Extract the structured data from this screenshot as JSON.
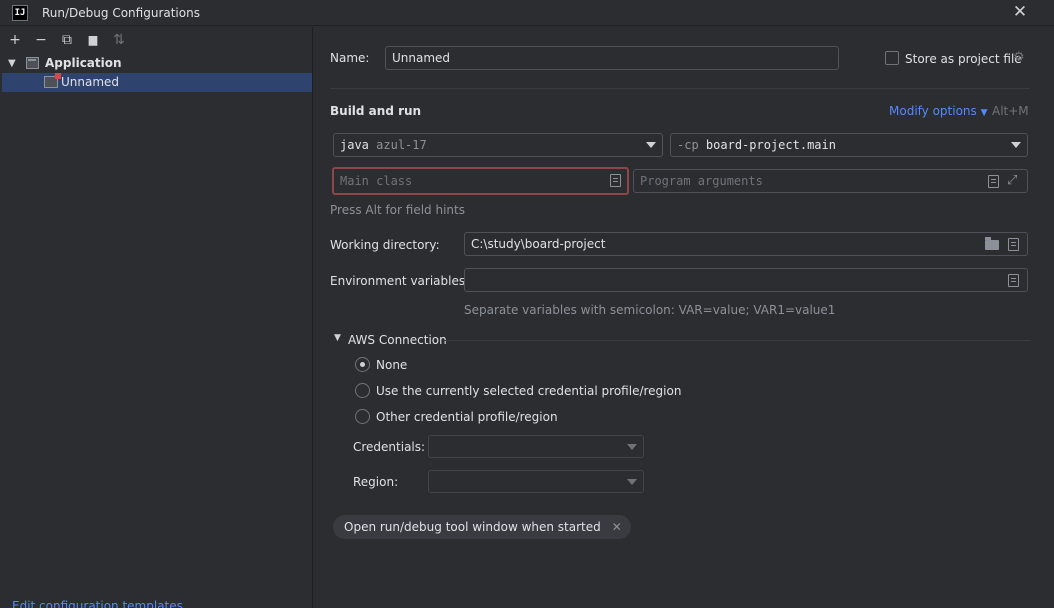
{
  "window": {
    "app_icon_text": "IJ",
    "title": "Run/Debug Configurations",
    "close_glyph": "✕"
  },
  "toolbar": {
    "add": "+",
    "remove": "−",
    "copy": "⧉",
    "folder": "▆",
    "sort": "⇅"
  },
  "tree": {
    "group_label": "Application",
    "item_label": "Unnamed"
  },
  "left_footer": {
    "edit_templates": "Edit configuration templates..."
  },
  "form": {
    "name_label": "Name:",
    "name_value": "Unnamed",
    "store_as_project_file": "Store as project file",
    "build_and_run": "Build and run",
    "modify_options": "Modify options",
    "modify_shortcut": "Alt+M",
    "jdk_prefix": "java",
    "jdk_value": "azul-17",
    "classpath_prefix": "-cp",
    "classpath_value": "board-project.main",
    "main_class_placeholder": "Main class",
    "program_args_placeholder": "Program arguments",
    "field_hint": "Press Alt for field hints",
    "working_dir_label": "Working directory:",
    "working_dir_value": "C:\\study\\board-project",
    "env_vars_label": "Environment variables:",
    "env_vars_value": "",
    "env_vars_hint": "Separate variables with semicolon: VAR=value; VAR1=value1"
  },
  "aws": {
    "section_title": "AWS Connection",
    "options": [
      {
        "label": "None",
        "selected": true
      },
      {
        "label": "Use the currently selected credential profile/region",
        "selected": false
      },
      {
        "label": "Other credential profile/region",
        "selected": false
      }
    ],
    "credentials_label": "Credentials:",
    "region_label": "Region:"
  },
  "chip": {
    "label": "Open run/debug tool window when started",
    "remove_glyph": "✕"
  },
  "colors": {
    "background": "#2b2d30",
    "selection": "#2e436e",
    "link": "#548af7",
    "error_border": "#8e4748"
  }
}
